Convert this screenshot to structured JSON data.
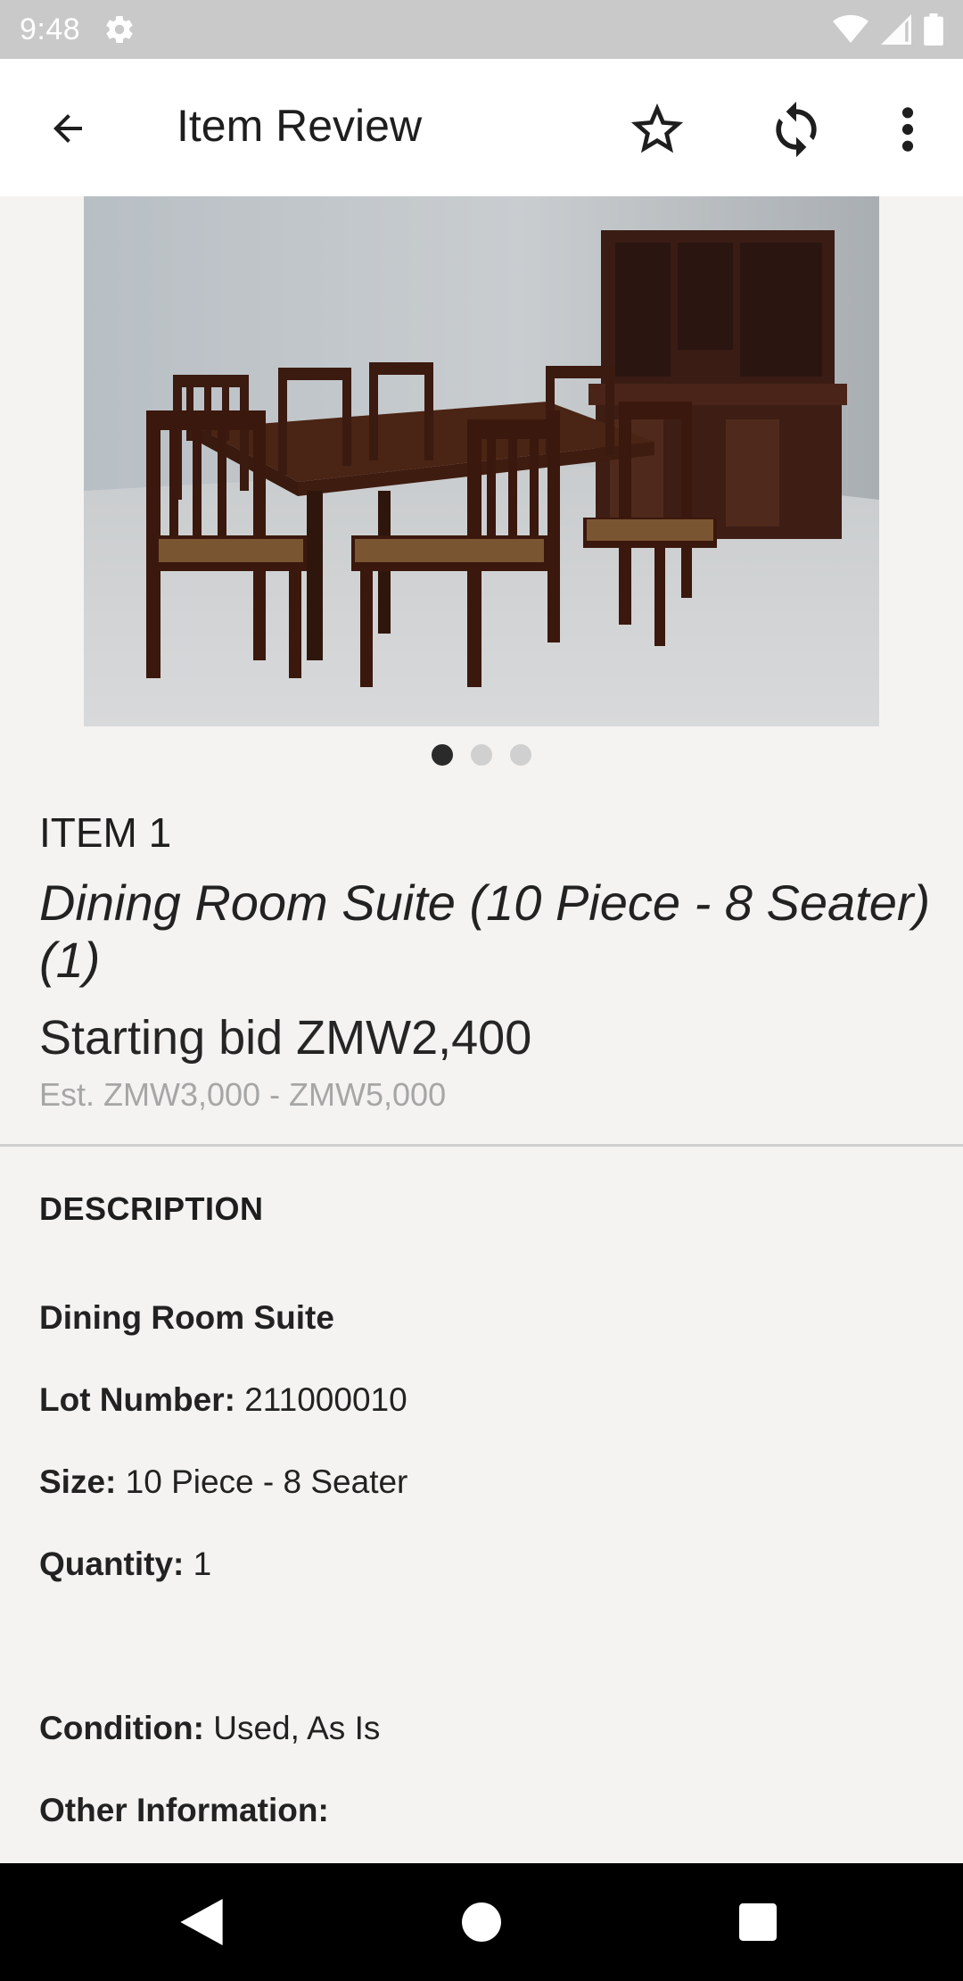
{
  "status_bar": {
    "time": "9:48",
    "icons": [
      "settings-icon",
      "wifi-icon",
      "cell-signal-icon",
      "battery-icon"
    ]
  },
  "app_bar": {
    "title": "Item Review",
    "icons": [
      "back-arrow-icon",
      "star-outline-icon",
      "refresh-icon",
      "more-vert-icon"
    ]
  },
  "gallery": {
    "page_count": 3,
    "current_page": 1
  },
  "item": {
    "number": "ITEM 1",
    "title": "Dining Room Suite (10 Piece - 8 Seater) (1)",
    "starting_bid": "Starting bid ZMW2,400",
    "estimate": "Est. ZMW3,000 - ZMW5,000"
  },
  "description": {
    "heading": "DESCRIPTION",
    "name": "Dining Room Suite",
    "lot_label": "Lot Number:",
    "lot_value": "211000010",
    "size_label": "Size:",
    "size_value": "10 Piece - 8 Seater",
    "quantity_label": "Quantity:",
    "quantity_value": "1",
    "condition_label": "Condition:",
    "condition_value": "Used, As Is",
    "other_label": "Other Information:",
    "other_value": ""
  },
  "nav_bar": {
    "icons": [
      "back-triangle-icon",
      "home-circle-icon",
      "recents-square-icon"
    ]
  },
  "colors": {
    "background": "#f4f3f1",
    "status_bar": "#c9c9c9",
    "app_bar": "#ffffff",
    "pager_active": "#2a2a2a",
    "pager_inactive": "#d0d0d0",
    "estimate_text": "#a6a6a6"
  }
}
